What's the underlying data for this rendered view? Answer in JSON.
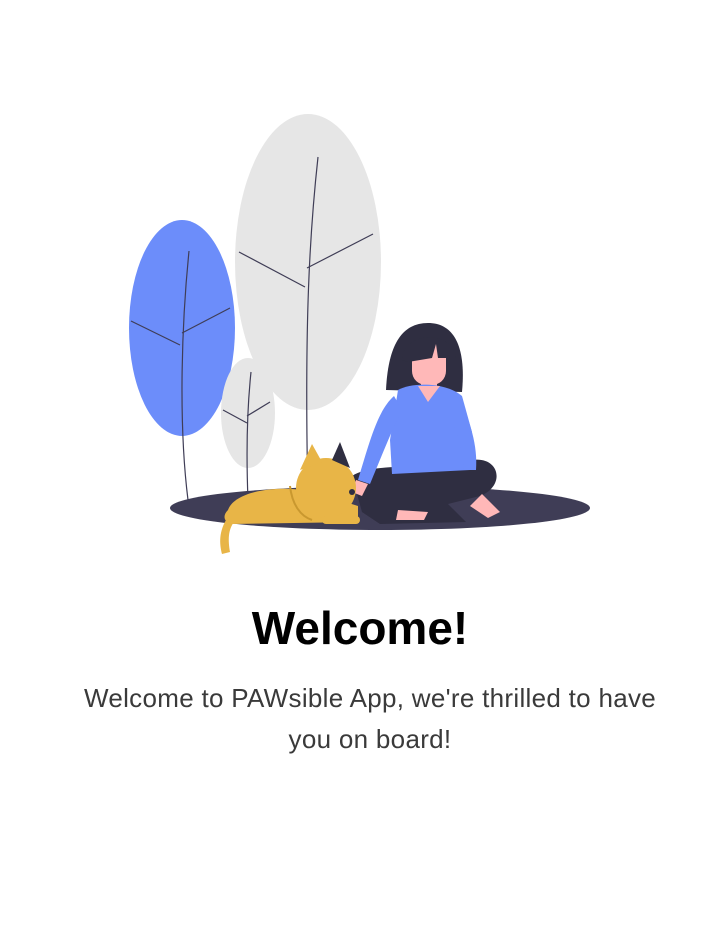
{
  "onboarding": {
    "title": "Welcome!",
    "message": "Welcome to PAWsible App, we're thrilled to have you on board!"
  },
  "illustration": {
    "icon": "woman-with-cat-illustration",
    "colors": {
      "accent_blue": "#6c8dfa",
      "tree_gray": "#e6e6e6",
      "cat_yellow": "#e8b547",
      "ground_dark": "#3f3d56",
      "hair_dark": "#2f2e41",
      "skin": "#ffb8b8"
    }
  }
}
